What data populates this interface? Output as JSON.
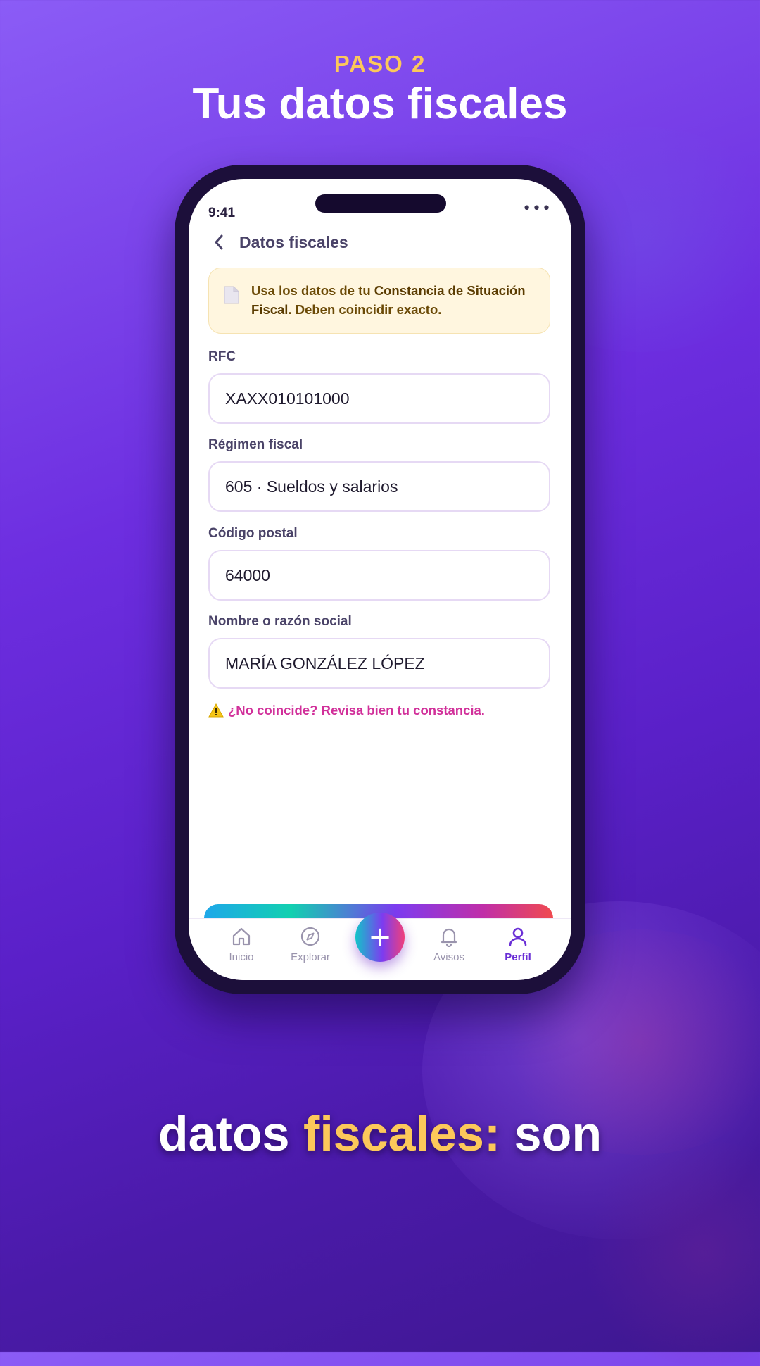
{
  "header": {
    "step": "PASO 2",
    "title": "Tus datos fiscales"
  },
  "status_bar": {
    "time": "9:41",
    "menu_glyph": "•••"
  },
  "screen": {
    "title": "Datos fiscales",
    "notice": {
      "prefix": "Usa los datos de tu ",
      "emphasis": "Constancia de Situación Fiscal",
      "suffix": ". Deben coincidir exacto."
    },
    "fields": [
      {
        "label": "RFC",
        "value": "XAXX010101000"
      },
      {
        "label": "Régimen fiscal",
        "value": "605 · Sueldos y salarios"
      },
      {
        "label": "Código postal",
        "value": "64000"
      },
      {
        "label": "Nombre o razón social",
        "value": "MARÍA GONZÁLEZ LÓPEZ"
      }
    ],
    "warning": "¿No coincide? Revisa bien tu constancia."
  },
  "tabbar": {
    "items": [
      {
        "label": "Inicio",
        "icon": "home-icon"
      },
      {
        "label": "Explorar",
        "icon": "compass-icon"
      },
      {
        "label": "Avisos",
        "icon": "bell-icon"
      },
      {
        "label": "Perfil",
        "icon": "user-icon",
        "active": true
      }
    ],
    "fab_glyph": "+"
  },
  "caption": {
    "word1": "datos",
    "word2": "fiscales:",
    "word3": "son"
  },
  "colors": {
    "accent": "#6a2fd6",
    "highlight": "#fcc85a",
    "warning": "#d1309a",
    "notice_bg": "#fff6df"
  }
}
